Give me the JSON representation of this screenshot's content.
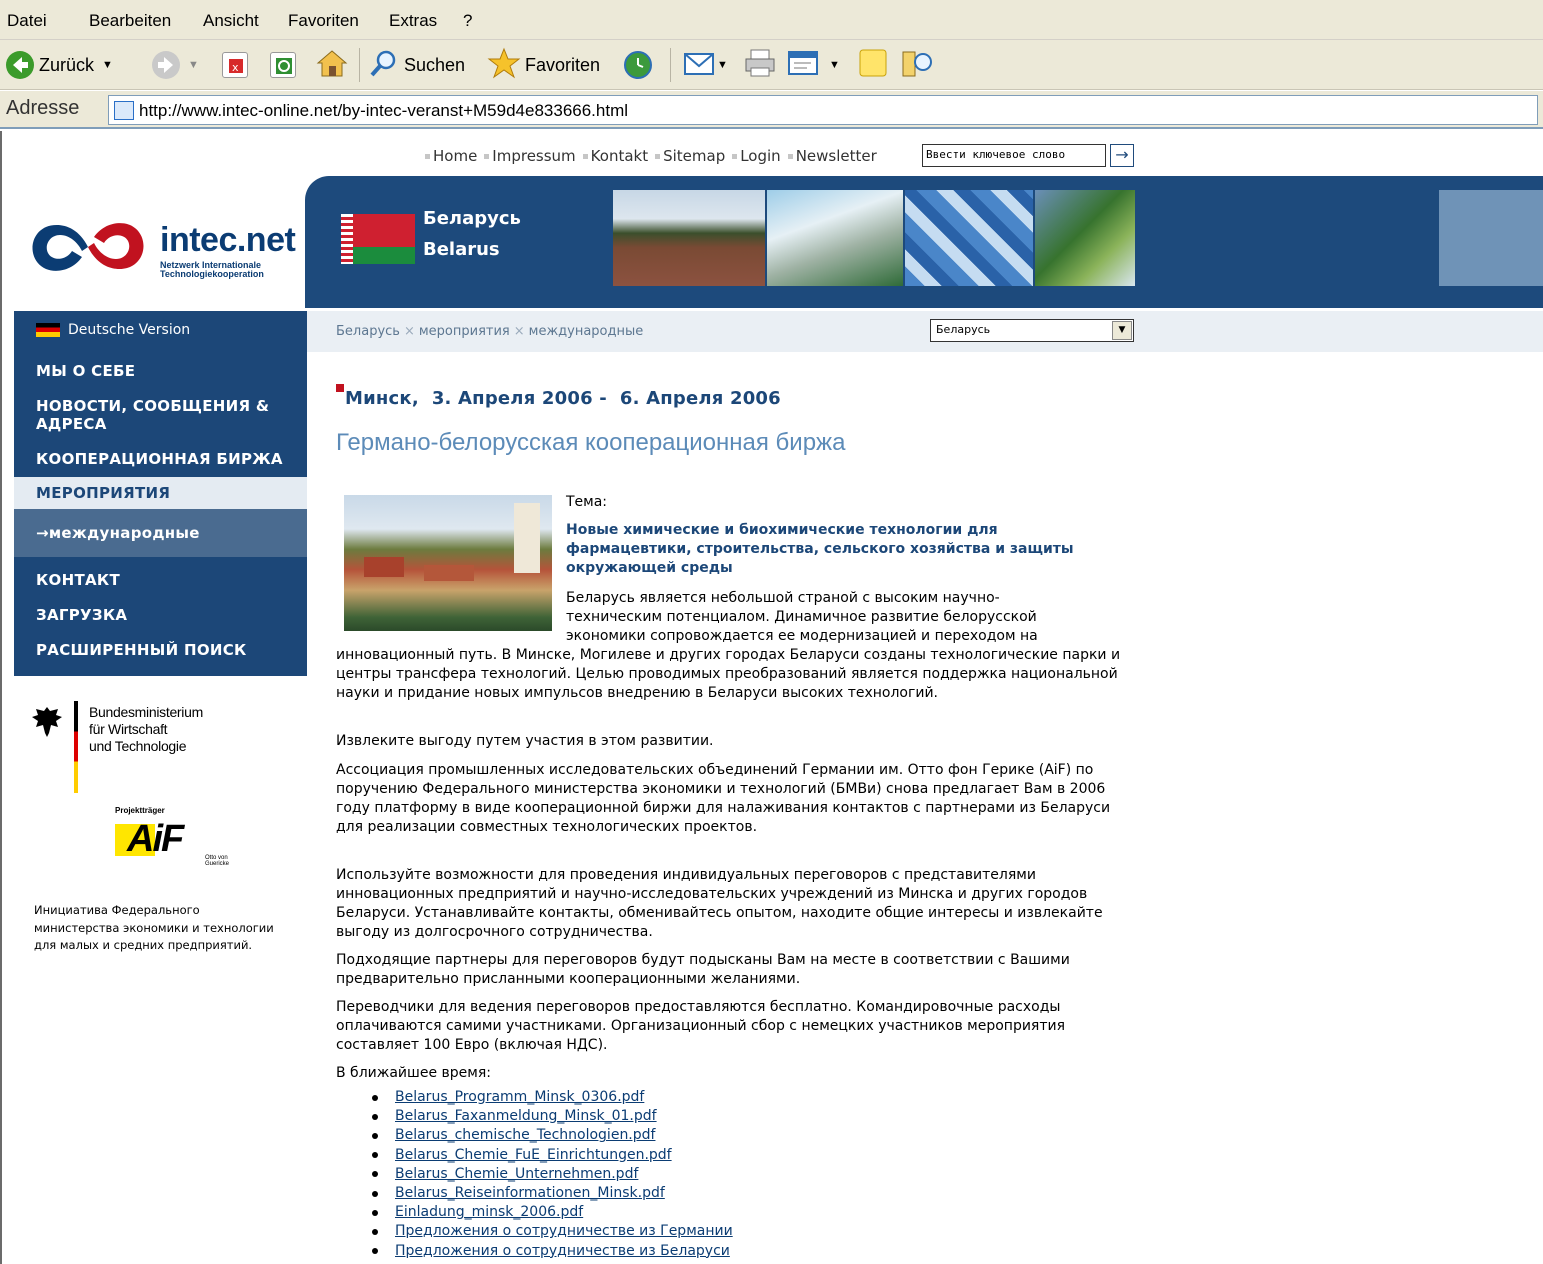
{
  "browser": {
    "menu": [
      "Datei",
      "Bearbeiten",
      "Ansicht",
      "Favoriten",
      "Extras",
      "?"
    ],
    "toolbar": {
      "back": "Zurück",
      "search": "Suchen",
      "favorites": "Favoriten"
    },
    "address_label": "Adresse",
    "url": "http://www.intec-online.net/by-intec-veranst+M59d4e833666.html"
  },
  "header": {
    "topnav": [
      "Home",
      "Impressum",
      "Kontakt",
      "Sitemap",
      "Login",
      "Newsletter"
    ],
    "search_value": "Ввести ключевое слово",
    "logo_name": "intec.net",
    "logo_sub1": "Netzwerk Internationale",
    "logo_sub2": "Technologiekooperation",
    "country_ru": "Беларусь",
    "country_en": "Belarus"
  },
  "sidebar": {
    "language": "Deutsche Version",
    "items": [
      "МЫ О СЕБЕ",
      "НОВОСТИ, СООБЩЕНИЯ & АДРЕСА",
      "КООПЕРАЦИОННАЯ БИРЖА",
      "МЕРОПРИЯТИЯ",
      "→международные",
      "КОНТАКТ",
      "ЗАГРУЗКА",
      "РАСШИРЕННЫЙ ПОИСК"
    ],
    "bmwi": [
      "Bundesministerium",
      "für Wirtschaft",
      "und Technologie"
    ],
    "aif_label": "Projektträger",
    "aif_mark": "AiF",
    "aif_sub": "Otto von Guericke",
    "initiative": "Инициатива Федерального министерства экономики и технологии для малых и средних предприятий."
  },
  "breadcrumb": {
    "items": [
      "Беларусь",
      "мероприятия",
      "международные"
    ],
    "separator": "×",
    "country_select": "Беларусь"
  },
  "content": {
    "date": "Минск,  3. Апреля 2006 -  6. Апреля 2006",
    "title": "Германо-белорусская кооперационная биржа",
    "tema_label": "Тема:",
    "topic": "Новые химические и биохимические технологии для фармацевтики, строительства, сельского хозяйства и защиты окружающей среды",
    "p1_lines": [
      "Беларусь является небольшой страной с высоким научно-",
      "техническим потенциалом. Динамичное развитие белорусской",
      "экономики сопровождается ее модернизацией и переходом на"
    ],
    "p1_rest": "инновационный путь. В Минске, Могилеве и других городах Беларуси созданы технологические парки и центры трансфера технологий. Целью проводимых преобразований является поддержка национальной науки и придание новых импульсов внедрению в Беларуси высоких технологий.",
    "p2": "Извлеките выгоду путем участия в этом развитии.",
    "p3": "Ассоциация промышленных исследовательских объединений Германии им. Отто фон Герике (AiF) по поручению Федерального министерства экономики и технологий (БМВи) снова предлагает Вам в 2006 году платформу в виде кооперационной биржи для налаживания контактов с партнерами из Беларуси для реализации совместных технологических проектов.",
    "p4": "Используйте возможности для проведения индивидуальных переговоров с представителями инновационных предприятий и научно-исследовательских учреждений из Минска и других городов Беларуси. Устанавливайте контакты, обменивайтесь опытом, находите общие интересы и извлекайте выгоду из долгосрочного сотрудничества.",
    "p5": "Подходящие партнеры для переговоров будут подысканы Вам на месте в соответствии с Вашими предварительно присланными кооперационными желаниями.",
    "p6": "Переводчики для ведения переговоров предоставляются бесплатно. Командировочные расходы оплачиваются самими участниками. Организационный сбор с немецких участников мероприятия составляет 100 Евро (включая НДС).",
    "soon_label": "В ближайшее время:",
    "downloads": [
      "Belarus_Programm_Minsk_0306.pdf",
      "Belarus_Faxanmeldung_Minsk_01.pdf",
      "Belarus_chemische_Technologien.pdf",
      "Belarus_Chemie_FuE_Einrichtungen.pdf",
      "Belarus_Chemie_Unternehmen.pdf",
      "Belarus_Reiseinformationen_Minsk.pdf",
      "Einladung_minsk_2006.pdf",
      "Предложения о сотрудничестве из Германии",
      "Предложения о сотрудничестве из Беларуси"
    ]
  },
  "colors": {
    "navy": "#1c4778",
    "title_blue": "#5c8bb8",
    "accent_red": "#c1121f"
  }
}
